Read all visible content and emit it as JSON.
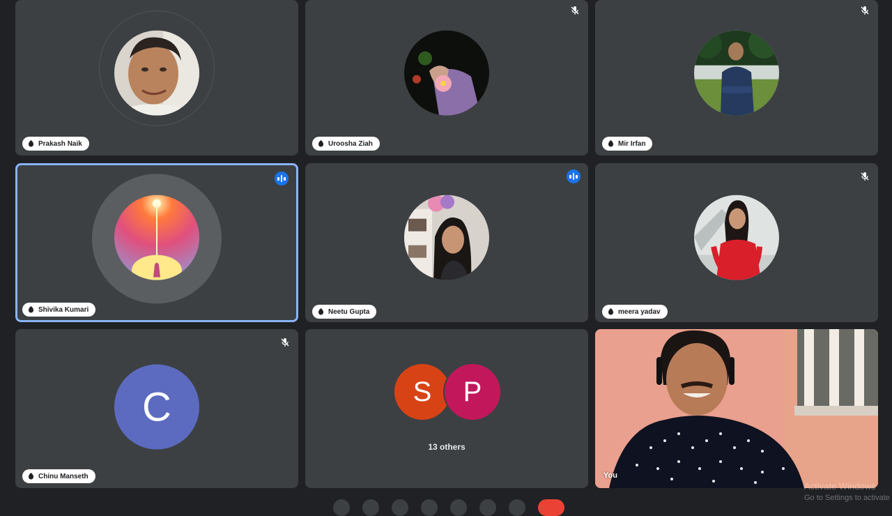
{
  "participants": [
    {
      "name": "Prakash Naik",
      "muted": false
    },
    {
      "name": "Uroosha Ziah",
      "muted": true
    },
    {
      "name": "Mir Irfan",
      "muted": true
    },
    {
      "name": "Shivika Kumari",
      "speaking": true
    },
    {
      "name": "Neetu Gupta",
      "speaking": true
    },
    {
      "name": "meera yadav",
      "muted": true
    },
    {
      "name": "Chinu Manseth",
      "muted": true,
      "initial": "C",
      "color": "#5c6bc0"
    }
  ],
  "others": {
    "avatars": [
      {
        "initial": "S",
        "color": "#d84315"
      },
      {
        "initial": "P",
        "color": "#c2185b"
      }
    ],
    "label": "13 others"
  },
  "self": {
    "label": "You"
  },
  "watermark": {
    "line1": "Activate Windows",
    "line2": "Go to Settings to activate Windows."
  },
  "colors": {
    "tile": "#3c4043",
    "background": "#202124",
    "speaking_border": "#8ab4f8",
    "speak_badge": "#1a73e8"
  }
}
